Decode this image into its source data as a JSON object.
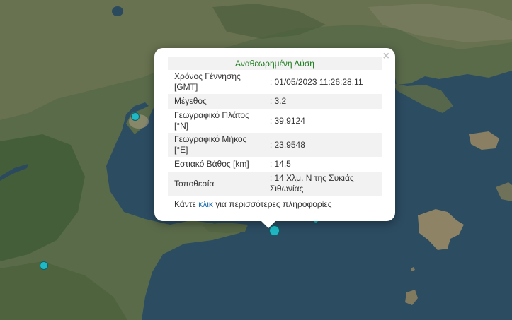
{
  "popup": {
    "title": "Αναθεωρημένη Λύση",
    "close_symbol": "×",
    "rows": [
      {
        "label": "Χρόνος Γέννησης [GMT]",
        "value": ": 01/05/2023 11:26:28.11"
      },
      {
        "label": "Μέγεθος",
        "value": ": 3.2"
      },
      {
        "label": "Γεωγραφικό Πλάτος [°N]",
        "value": ": 39.9124"
      },
      {
        "label": "Γεωγραφικό Μήκος [°E]",
        "value": ": 23.9548"
      },
      {
        "label": "Εστιακό Βάθος [km]",
        "value": ": 14.5"
      },
      {
        "label": "Τοποθεσία",
        "value": ": 14 Χλμ. Ν της Συκιάς Σιθωνίας"
      }
    ],
    "more_prefix": "Κάντε",
    "more_link": "κλικ",
    "more_suffix": "για περισσότερες πληροφορίες"
  },
  "colors": {
    "quake_marker": "#1fb8c4",
    "title_text": "#1a7a1a",
    "link": "#1a6fb0"
  },
  "icons": {
    "close": "close-icon",
    "earthquake_marker": "earthquake-marker-icon"
  }
}
